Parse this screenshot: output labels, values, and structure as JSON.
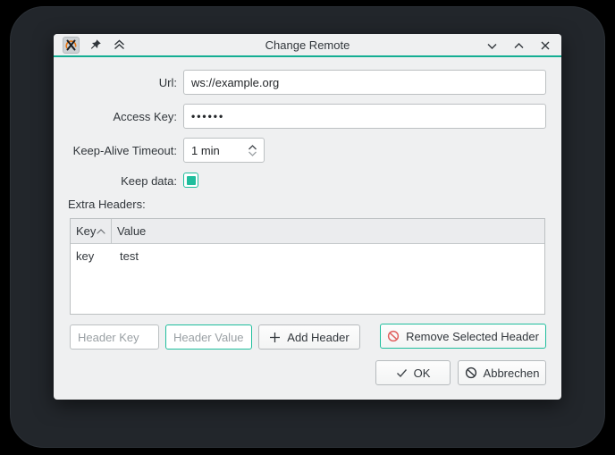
{
  "window": {
    "title": "Change Remote"
  },
  "titlebar": {
    "icons": [
      "app-icon",
      "pin-icon",
      "keep-above-icon"
    ],
    "controls": [
      "minimize",
      "maximize",
      "close"
    ]
  },
  "form": {
    "url_label": "Url:",
    "url_value": "ws://example.org",
    "access_key_label": "Access Key:",
    "access_key_value": "••••••",
    "timeout_label": "Keep-Alive Timeout:",
    "timeout_value": "1 min",
    "keep_data_label": "Keep data:",
    "keep_data_checked": true,
    "extra_headers_label": "Extra Headers:"
  },
  "table": {
    "columns": [
      "Key",
      "Value"
    ],
    "sort": {
      "column": "Key",
      "direction": "ascending"
    },
    "rows": [
      {
        "key": "key",
        "value": "test"
      }
    ]
  },
  "header_editor": {
    "key_placeholder": "Header Key",
    "value_placeholder": "Header Value",
    "add_label": "Add Header",
    "remove_label": "Remove Selected Header"
  },
  "dialog_buttons": {
    "ok": "OK",
    "cancel": "Abbrechen"
  },
  "colors": {
    "accent": "#1abc9c",
    "danger": "#e0615f",
    "window_bg": "#eff0f1",
    "screen_bg": "#22262b"
  }
}
